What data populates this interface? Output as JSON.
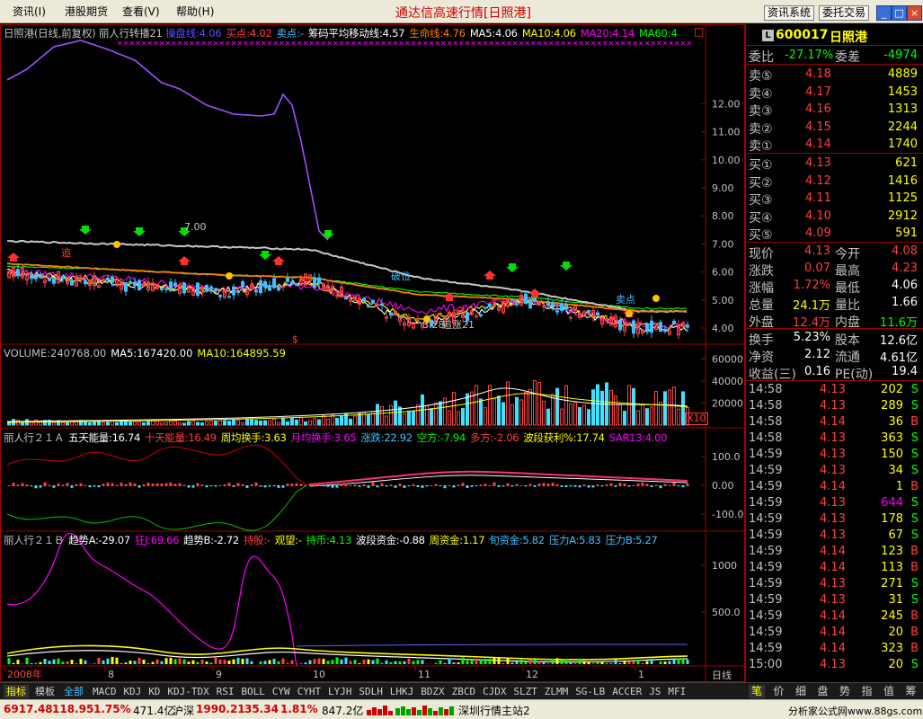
{
  "menu": {
    "items": [
      "资讯(I)",
      "港股期货",
      "查看(V)",
      "帮助(H)"
    ]
  },
  "app_title": "通达信高速行情[日照港]",
  "top_buttons": {
    "news": "资讯系统",
    "trade": "委托交易"
  },
  "window_buttons": {
    "min": "_",
    "max": "□",
    "close": "×"
  },
  "chart": {
    "main": {
      "title": "日照港(日线,前复权)",
      "indicator_name": "丽人行转播21",
      "labels": [
        {
          "text": "操盘线:4.06",
          "color": "#5050ff"
        },
        {
          "text": "买点:4.02",
          "color": "#ff4040"
        },
        {
          "text": "卖点:-",
          "color": "#40c0ff"
        },
        {
          "text": "筹码平均移动线:4.57",
          "color": "#ffffff"
        },
        {
          "text": "生命线:4.76",
          "color": "#ff8000"
        },
        {
          "text": "MA5:4.06",
          "color": "#ffffff"
        },
        {
          "text": "MA10:4.06",
          "color": "#ffff00"
        },
        {
          "text": "MA20:4.14",
          "color": "#ff00ff"
        },
        {
          "text": "MA60:4",
          "color": "#00ff00"
        }
      ],
      "close_icon": "□",
      "price_ticks": [
        "12.00",
        "11.00",
        "10.00",
        "9.00",
        "8.00",
        "7.00",
        "6.00",
        "5.00",
        "4.00"
      ],
      "annotation_top": "7.00",
      "annotation_bottom": "3.28",
      "annotation_bottom2": "追涨21",
      "sell_text_1": "卖点",
      "sell_text_2": "破位",
      "marker_text": "追"
    },
    "volume": {
      "labels": [
        {
          "text": "VOLUME:240768.00",
          "color": "#c0c0c0"
        },
        {
          "text": "MA5:167420.00",
          "color": "#ffffff"
        },
        {
          "text": "MA10:164895.59",
          "color": "#ffff00"
        }
      ],
      "ticks": [
        "60000",
        "40000",
        "20000"
      ],
      "multiplier": "X10"
    },
    "ind1": {
      "labels": [
        {
          "text": "丽人行２１Ａ",
          "color": "#c0c0c0"
        },
        {
          "text": "五天能量:16.74",
          "color": "#ffffff"
        },
        {
          "text": "十天能量:16.49",
          "color": "#ff4040"
        },
        {
          "text": "周均换手:3.63",
          "color": "#ffff00"
        },
        {
          "text": "月均换手:3.65",
          "color": "#ff00ff"
        },
        {
          "text": "涨跌:22.92",
          "color": "#40c0ff"
        },
        {
          "text": "空方:-7.94",
          "color": "#00ff00"
        },
        {
          "text": "多方:-2.06",
          "color": "#ff4040"
        },
        {
          "text": "波段获利%:17.74",
          "color": "#ffff00"
        },
        {
          "text": "SAR13:4.00",
          "color": "#ff00ff"
        }
      ],
      "ticks": [
        "100.0",
        "0.00",
        "-100.0"
      ]
    },
    "ind2": {
      "labels": [
        {
          "text": "丽人行２１Ｂ",
          "color": "#c0c0c0"
        },
        {
          "text": "趋势A:-29.07",
          "color": "#ffffff"
        },
        {
          "text": "狂J:69.66",
          "color": "#ff00ff"
        },
        {
          "text": "趋势B:-2.72",
          "color": "#ffffff"
        },
        {
          "text": "持股:-",
          "color": "#ff4040"
        },
        {
          "text": "观望:-",
          "color": "#ffff00"
        },
        {
          "text": "持币:4.13",
          "color": "#00ff00"
        },
        {
          "text": "波段资金:-0.88",
          "color": "#ffffff"
        },
        {
          "text": "周资金:1.17",
          "color": "#ffff00"
        },
        {
          "text": "旬资金:5.82",
          "color": "#40c0ff"
        },
        {
          "text": "压力A:5.83",
          "color": "#40c0ff"
        },
        {
          "text": "压力B:5.27",
          "color": "#40c0ff"
        }
      ],
      "ticks": [
        "1000",
        "500.0"
      ]
    },
    "x_axis": {
      "labels": [
        "2008年",
        "8",
        "9",
        "10",
        "11",
        "12",
        "1"
      ],
      "period": "日线"
    }
  },
  "chart_data": {
    "type": "line",
    "x": [
      "2008-07",
      "2008-08",
      "2008-09",
      "2008-10",
      "2008-11",
      "2008-12",
      "2009-01"
    ],
    "title": "日照港(日线,前复权)",
    "series": [
      {
        "name": "MA5",
        "values": [
          6.0,
          5.6,
          5.3,
          5.7,
          4.1,
          5.0,
          4.0
        ]
      },
      {
        "name": "MA10",
        "values": [
          6.0,
          5.7,
          5.3,
          5.6,
          4.3,
          5.0,
          4.1
        ]
      },
      {
        "name": "MA20",
        "values": [
          6.0,
          5.8,
          5.4,
          5.5,
          4.6,
          5.0,
          4.1
        ]
      },
      {
        "name": "MA60",
        "values": [
          6.2,
          6.1,
          5.9,
          5.8,
          5.3,
          5.1,
          4.7
        ]
      },
      {
        "name": "筹码平均移动线",
        "values": [
          7.1,
          7.0,
          6.9,
          6.8,
          5.8,
          5.3,
          4.6
        ]
      }
    ],
    "ylim": [
      3.0,
      13.0
    ],
    "volume_series": [
      {
        "name": "VOLUME",
        "values": [
          4000,
          3000,
          3000,
          5000,
          18000,
          30000,
          24000
        ]
      }
    ]
  },
  "stock": {
    "code": "600017",
    "name": "日照港",
    "badge": "L"
  },
  "order_book": {
    "ratio_label": "委比",
    "ratio": "-27.17%",
    "diff_label": "委差",
    "diff": "-4974",
    "sell": [
      {
        "label": "卖⑤",
        "price": "4.18",
        "vol": "4889"
      },
      {
        "label": "卖④",
        "price": "4.17",
        "vol": "1453"
      },
      {
        "label": "卖③",
        "price": "4.16",
        "vol": "1313"
      },
      {
        "label": "卖②",
        "price": "4.15",
        "vol": "2244"
      },
      {
        "label": "卖①",
        "price": "4.14",
        "vol": "1740"
      }
    ],
    "buy": [
      {
        "label": "买①",
        "price": "4.13",
        "vol": "621"
      },
      {
        "label": "买②",
        "price": "4.12",
        "vol": "1416"
      },
      {
        "label": "买③",
        "price": "4.11",
        "vol": "1125"
      },
      {
        "label": "买④",
        "price": "4.10",
        "vol": "2912"
      },
      {
        "label": "买⑤",
        "price": "4.09",
        "vol": "591"
      }
    ]
  },
  "quote": {
    "rows": [
      {
        "l1": "现价",
        "v1": "4.13",
        "c1": "#ff4040",
        "l2": "今开",
        "v2": "4.08",
        "c2": "#ff4040"
      },
      {
        "l1": "涨跌",
        "v1": "0.07",
        "c1": "#ff4040",
        "l2": "最高",
        "v2": "4.23",
        "c2": "#ff4040"
      },
      {
        "l1": "涨幅",
        "v1": "1.72%",
        "c1": "#ff4040",
        "l2": "最低",
        "v2": "4.06",
        "c2": "#ffffff"
      },
      {
        "l1": "总量",
        "v1": "24.1万",
        "c1": "#ffff00",
        "l2": "量比",
        "v2": "1.66",
        "c2": "#ffffff"
      },
      {
        "l1": "外盘",
        "v1": "12.4万",
        "c1": "#ff4040",
        "l2": "内盘",
        "v2": "11.6万",
        "c2": "#00ff00"
      }
    ],
    "rows2": [
      {
        "l1": "换手",
        "v1": "5.23%",
        "c1": "#ffffff",
        "l2": "股本",
        "v2": "12.6亿",
        "c2": "#ffffff"
      },
      {
        "l1": "净资",
        "v1": "2.12",
        "c1": "#ffffff",
        "l2": "流通",
        "v2": "4.61亿",
        "c2": "#ffffff"
      },
      {
        "l1": "收益(三)",
        "v1": "0.16",
        "c1": "#ffffff",
        "l2": "PE(动)",
        "v2": "19.4",
        "c2": "#ffffff"
      }
    ]
  },
  "ticks": [
    {
      "t": "14:58",
      "p": "4.13",
      "v": "202",
      "s": "S",
      "pc": "#ff4040",
      "vc": "#ffff00",
      "sc": "#00ff00"
    },
    {
      "t": "14:58",
      "p": "4.13",
      "v": "289",
      "s": "S",
      "pc": "#ff4040",
      "vc": "#ffff00",
      "sc": "#00ff00"
    },
    {
      "t": "14:58",
      "p": "4.14",
      "v": "36",
      "s": "B",
      "pc": "#ff4040",
      "vc": "#ffff00",
      "sc": "#ff4040"
    },
    {
      "t": "14:58",
      "p": "4.13",
      "v": "363",
      "s": "S",
      "pc": "#ff4040",
      "vc": "#ffff00",
      "sc": "#00ff00"
    },
    {
      "t": "14:59",
      "p": "4.13",
      "v": "150",
      "s": "S",
      "pc": "#ff4040",
      "vc": "#ffff00",
      "sc": "#00ff00"
    },
    {
      "t": "14:59",
      "p": "4.13",
      "v": "34",
      "s": "S",
      "pc": "#ff4040",
      "vc": "#ffff00",
      "sc": "#00ff00"
    },
    {
      "t": "14:59",
      "p": "4.14",
      "v": "1",
      "s": "B",
      "pc": "#ff4040",
      "vc": "#ffff00",
      "sc": "#ff4040"
    },
    {
      "t": "14:59",
      "p": "4.13",
      "v": "644",
      "s": "S",
      "pc": "#ff4040",
      "vc": "#ff00ff",
      "sc": "#00ff00"
    },
    {
      "t": "14:59",
      "p": "4.13",
      "v": "178",
      "s": "S",
      "pc": "#ff4040",
      "vc": "#ffff00",
      "sc": "#00ff00"
    },
    {
      "t": "14:59",
      "p": "4.13",
      "v": "67",
      "s": "S",
      "pc": "#ff4040",
      "vc": "#ffff00",
      "sc": "#00ff00"
    },
    {
      "t": "14:59",
      "p": "4.14",
      "v": "123",
      "s": "B",
      "pc": "#ff4040",
      "vc": "#ffff00",
      "sc": "#ff4040"
    },
    {
      "t": "14:59",
      "p": "4.14",
      "v": "113",
      "s": "B",
      "pc": "#ff4040",
      "vc": "#ffff00",
      "sc": "#ff4040"
    },
    {
      "t": "14:59",
      "p": "4.13",
      "v": "271",
      "s": "S",
      "pc": "#ff4040",
      "vc": "#ffff00",
      "sc": "#00ff00"
    },
    {
      "t": "14:59",
      "p": "4.13",
      "v": "31",
      "s": "S",
      "pc": "#ff4040",
      "vc": "#ffff00",
      "sc": "#00ff00"
    },
    {
      "t": "14:59",
      "p": "4.14",
      "v": "245",
      "s": "B",
      "pc": "#ff4040",
      "vc": "#ffff00",
      "sc": "#ff4040"
    },
    {
      "t": "14:59",
      "p": "4.14",
      "v": "20",
      "s": "B",
      "pc": "#ff4040",
      "vc": "#ffff00",
      "sc": "#ff4040"
    },
    {
      "t": "14:59",
      "p": "4.14",
      "v": "323",
      "s": "B",
      "pc": "#ff4040",
      "vc": "#ffff00",
      "sc": "#ff4040"
    },
    {
      "t": "15:00",
      "p": "4.13",
      "v": "20",
      "s": "S",
      "pc": "#ff4040",
      "vc": "#ffff00",
      "sc": "#00ff00"
    }
  ],
  "right_tabs": [
    "笔",
    "价",
    "细",
    "盘",
    "势",
    "指",
    "值",
    "筹"
  ],
  "bottom_tabs": [
    "指标",
    "模板",
    "全部",
    "MACD",
    "KDJ",
    "KD",
    "KDJ-TDX",
    "RSI",
    "BOLL",
    "CYW",
    "CYHT",
    "LYJH",
    "SDLH",
    "LHKJ",
    "BDZX",
    "ZBCD",
    "CJDX",
    "SLZT",
    "ZLMM",
    "SG-LB",
    "ACCER",
    "JS",
    "MFI"
  ],
  "status": {
    "sh_index": "6917.48",
    "sh_change": "118.95",
    "sh_pct": "1.75%",
    "sh_amount": "471.4亿",
    "sz_label": "沪深",
    "sz_index": "1990.21",
    "sz_change": "35.34",
    "sz_pct": "1.81%",
    "sz_amount": "847.2亿",
    "server": "深圳行情主站2",
    "site": "分析家公式网www.88gs.com"
  }
}
